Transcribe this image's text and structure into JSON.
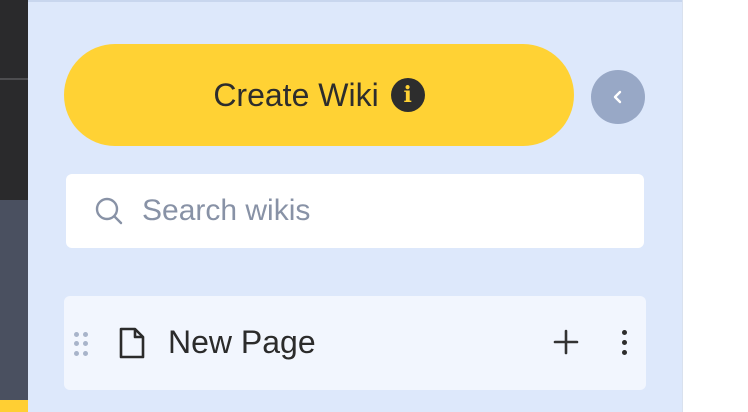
{
  "sidebar": {
    "create_button": {
      "label": "Create Wiki",
      "info_icon": "info-icon"
    },
    "collapse_icon": "chevron-left-icon",
    "search": {
      "placeholder": "Search wikis",
      "value": "",
      "icon": "search-icon"
    },
    "pages": [
      {
        "title": "New Page",
        "icon": "file-icon",
        "actions": [
          "plus-icon",
          "more-vertical-icon"
        ]
      }
    ]
  },
  "colors": {
    "panel_bg": "#dde8fb",
    "accent_yellow": "#ffd234",
    "collapse_button": "#98a8c6",
    "rail_dark": "#2a2a2c"
  }
}
